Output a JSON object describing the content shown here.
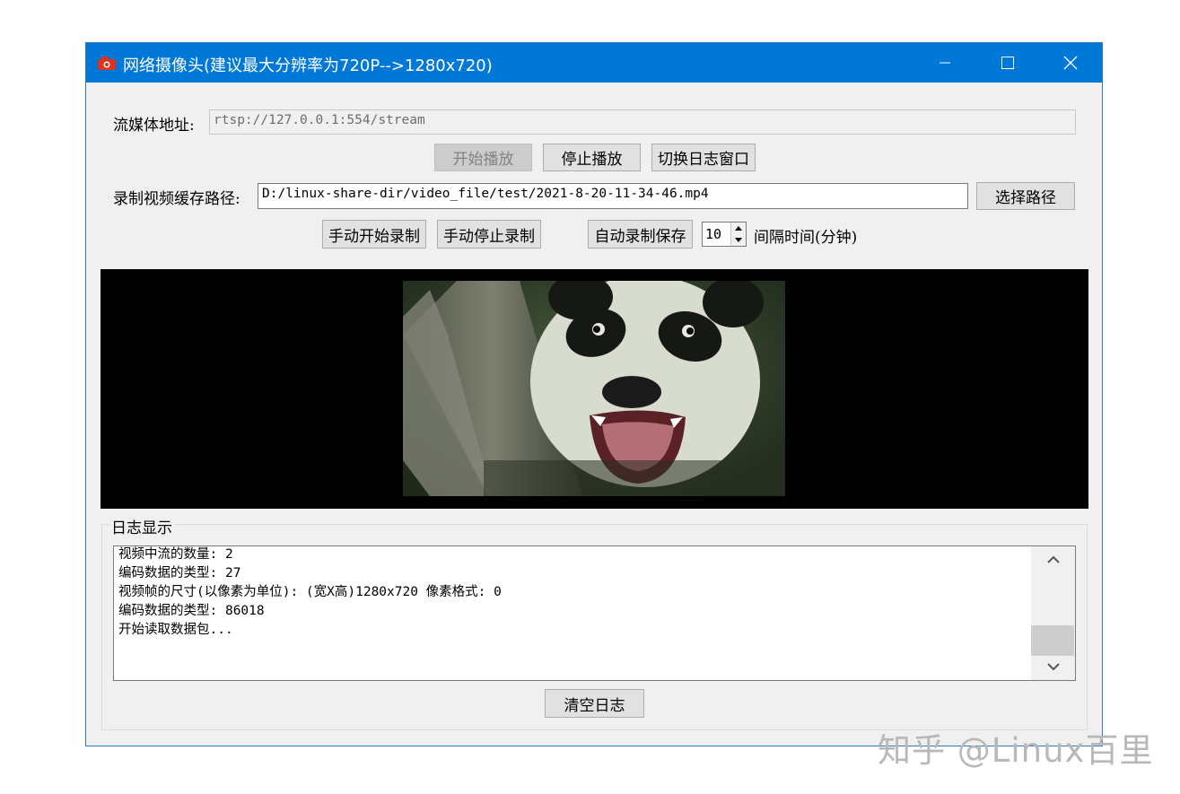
{
  "window": {
    "title": "网络摄像头(建议最大分辨率为720P-->1280x720)",
    "accent": "#0078d7",
    "controls": [
      "minimize-icon",
      "maximize-icon",
      "close-icon"
    ]
  },
  "stream": {
    "label": "流媒体地址:",
    "url": "rtsp://127.0.0.1:554/stream"
  },
  "playback": {
    "start_label": "开始播放",
    "stop_label": "停止播放",
    "toggle_log_label": "切换日志窗口"
  },
  "record": {
    "path_label": "录制视频缓存路径:",
    "path_value": "D:/linux-share-dir/video_file/test/2021-8-20-11-34-46.mp4",
    "choose_path_label": "选择路径",
    "manual_start_label": "手动开始录制",
    "manual_stop_label": "手动停止录制",
    "auto_save_label": "自动录制保存",
    "interval_value": "10",
    "interval_label": "间隔时间(分钟)"
  },
  "video": {
    "content": "panda-video-frame"
  },
  "log": {
    "group_title": "日志显示",
    "lines": [
      "视频中流的数量: 2",
      "编码数据的类型: 27",
      "视频帧的尺寸(以像素为单位): (宽X高)1280x720 像素格式: 0",
      "编码数据的类型: 86018",
      "开始读取数据包..."
    ],
    "clear_label": "清空日志"
  },
  "watermark": "知乎 @Linux百里"
}
